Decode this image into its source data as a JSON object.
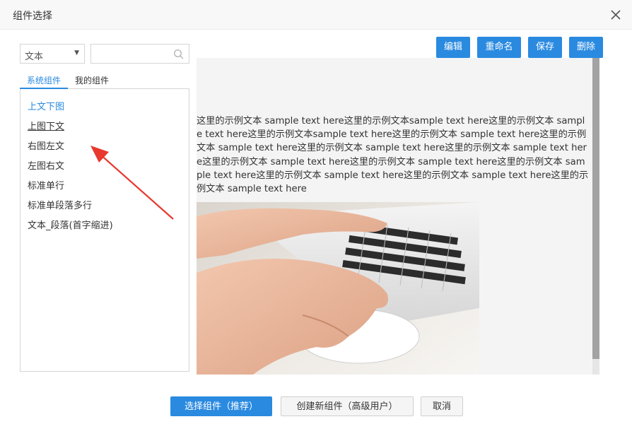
{
  "dialog": {
    "title": "组件选择",
    "close_icon": "close-icon"
  },
  "filter": {
    "type_value": "文本",
    "search_value": "",
    "search_icon": "search-icon"
  },
  "tabs": [
    {
      "label": "系统组件",
      "active": true
    },
    {
      "label": "我的组件",
      "active": false
    }
  ],
  "components": [
    {
      "label": "上文下图",
      "state": "selected"
    },
    {
      "label": "上图下文",
      "state": "hover"
    },
    {
      "label": "右图左文",
      "state": "normal"
    },
    {
      "label": "左图右文",
      "state": "normal"
    },
    {
      "label": "标准单行",
      "state": "normal"
    },
    {
      "label": "标准单段落多行",
      "state": "normal"
    },
    {
      "label": "文本_段落(首字缩进)",
      "state": "normal"
    }
  ],
  "toolbar": {
    "edit_label": "编辑",
    "rename_label": "重命名",
    "save_label": "保存",
    "delete_label": "删除"
  },
  "preview": {
    "text": "这里的示例文本 sample text here这里的示例文本sample text here这里的示例文本 sample text here这里的示例文本sample text here这里的示例文本 sample text here这里的示例文本 sample text here这里的示例文本 sample text here这里的示例文本 sample text here这里的示例文本 sample text here这里的示例文本 sample text here这里的示例文本 sample text here这里的示例文本 sample text here这里的示例文本 sample text here这里的示例文本 sample text here",
    "image_subject": "hands-typing-on-laptop-photo"
  },
  "footer": {
    "select_label": "选择组件（推荐）",
    "create_label": "创建新组件（高级用户）",
    "cancel_label": "取消"
  },
  "colors": {
    "accent": "#2a8ae0",
    "annotation_arrow": "#e8392f"
  }
}
